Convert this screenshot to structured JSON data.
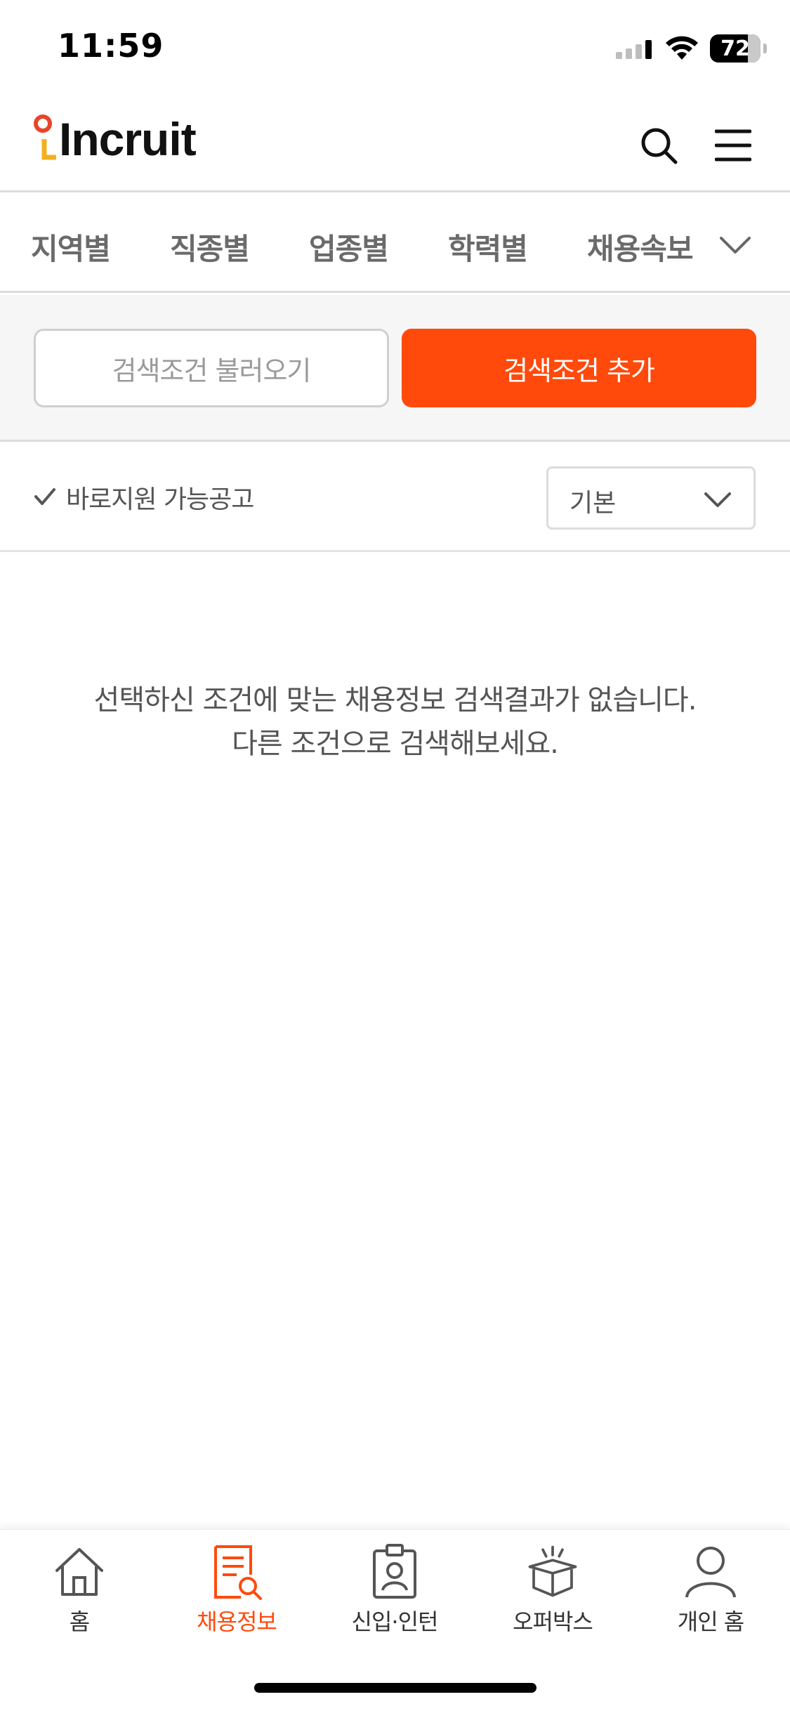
{
  "status_bar": {
    "time": "11:59",
    "battery": "72"
  },
  "header": {
    "logo_text": "Incruit"
  },
  "categories": [
    "지역별",
    "직종별",
    "업종별",
    "학력별",
    "채용속보"
  ],
  "conditions": {
    "load_label": "검색조건 불러오기",
    "add_label": "검색조건 추가"
  },
  "filter": {
    "direct_apply_label": "바로지원 가능공고",
    "sort_value": "기본"
  },
  "empty_state": {
    "line1": "선택하신 조건에 맞는 채용정보 검색결과가 없습니다.",
    "line2": "다른 조건으로 검색해보세요."
  },
  "tabs": [
    {
      "label": "홈",
      "icon": "house-icon",
      "active": false
    },
    {
      "label": "채용정보",
      "icon": "job-search-document-icon",
      "active": true
    },
    {
      "label": "신입·인턴",
      "icon": "id-badge-icon",
      "active": false
    },
    {
      "label": "오퍼박스",
      "icon": "open-box-icon",
      "active": false
    },
    {
      "label": "개인 홈",
      "icon": "person-icon",
      "active": false
    }
  ],
  "colors": {
    "accent": "#ff4a0c",
    "logo_red": "#e8452a",
    "logo_yellow": "#f2b01e"
  }
}
